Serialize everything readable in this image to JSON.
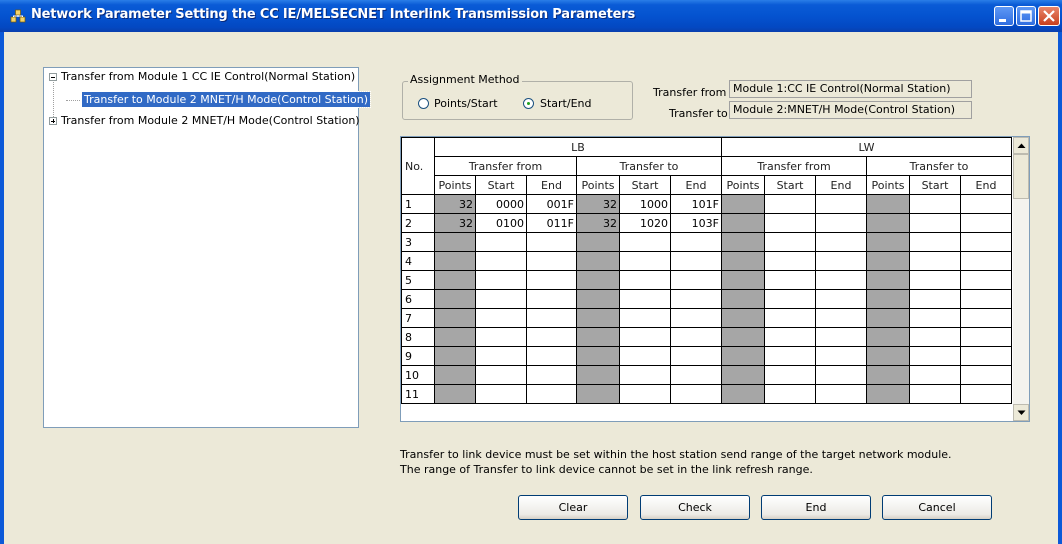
{
  "window": {
    "title": "Network Parameter  Setting the CC IE/MELSECNET Interlink Transmission Parameters"
  },
  "tree": {
    "items": [
      {
        "label": "Transfer from Module 1 CC IE Control(Normal Station)",
        "expander": "minus"
      },
      {
        "label": "Transfer to Module 2 MNET/H Mode(Control Station)",
        "selected": true
      },
      {
        "label": "Transfer from Module 2 MNET/H Mode(Control Station)",
        "expander": "plus"
      }
    ]
  },
  "assignment": {
    "legend": "Assignment Method",
    "options": [
      {
        "label": "Points/Start",
        "checked": false
      },
      {
        "label": "Start/End",
        "checked": true
      }
    ]
  },
  "transfer_info": {
    "from_label": "Transfer from",
    "from_value": "Module 1:CC IE Control(Normal Station)",
    "to_label": "Transfer to",
    "to_value": "Module 2:MNET/H Mode(Control Station)"
  },
  "grid": {
    "col_no": "No.",
    "groups": [
      "LB",
      "LW"
    ],
    "subgroups": [
      "Transfer from",
      "Transfer to",
      "Transfer from",
      "Transfer to"
    ],
    "columns": [
      "Points",
      "Start",
      "End",
      "Points",
      "Start",
      "End",
      "Points",
      "Start",
      "End",
      "Points",
      "Start",
      "End"
    ],
    "rows": [
      {
        "no": "1",
        "cells": [
          "32",
          "0000",
          "001F",
          "32",
          "1000",
          "101F",
          "",
          "",
          "",
          "",
          "",
          ""
        ]
      },
      {
        "no": "2",
        "cells": [
          "32",
          "0100",
          "011F",
          "32",
          "1020",
          "103F",
          "",
          "",
          "",
          "",
          "",
          ""
        ]
      },
      {
        "no": "3",
        "cells": [
          "",
          "",
          "",
          "",
          "",
          "",
          "",
          "",
          "",
          "",
          "",
          ""
        ]
      },
      {
        "no": "4",
        "cells": [
          "",
          "",
          "",
          "",
          "",
          "",
          "",
          "",
          "",
          "",
          "",
          ""
        ]
      },
      {
        "no": "5",
        "cells": [
          "",
          "",
          "",
          "",
          "",
          "",
          "",
          "",
          "",
          "",
          "",
          ""
        ]
      },
      {
        "no": "6",
        "cells": [
          "",
          "",
          "",
          "",
          "",
          "",
          "",
          "",
          "",
          "",
          "",
          ""
        ]
      },
      {
        "no": "7",
        "cells": [
          "",
          "",
          "",
          "",
          "",
          "",
          "",
          "",
          "",
          "",
          "",
          ""
        ]
      },
      {
        "no": "8",
        "cells": [
          "",
          "",
          "",
          "",
          "",
          "",
          "",
          "",
          "",
          "",
          "",
          ""
        ]
      },
      {
        "no": "9",
        "cells": [
          "",
          "",
          "",
          "",
          "",
          "",
          "",
          "",
          "",
          "",
          "",
          ""
        ]
      },
      {
        "no": "10",
        "cells": [
          "",
          "",
          "",
          "",
          "",
          "",
          "",
          "",
          "",
          "",
          "",
          ""
        ]
      },
      {
        "no": "11",
        "cells": [
          "",
          "",
          "",
          "",
          "",
          "",
          "",
          "",
          "",
          "",
          "",
          ""
        ]
      }
    ]
  },
  "messages": [
    "Transfer to link device must be set within the host station send range of the target network module.",
    "The range of Transfer to link device cannot be set in the link refresh range."
  ],
  "buttons": {
    "clear": "Clear",
    "check": "Check",
    "end": "End",
    "cancel": "Cancel"
  },
  "colors": {
    "titlebar": "#0453d0",
    "selection": "#316ac5",
    "grid_shade": "#a6a6a6",
    "window_bg": "#ece9d8"
  },
  "icons": [
    "network-parameter-icon",
    "minimize-icon",
    "maximize-icon",
    "close-icon",
    "scroll-up-arrow-icon",
    "scroll-down-arrow-icon"
  ]
}
